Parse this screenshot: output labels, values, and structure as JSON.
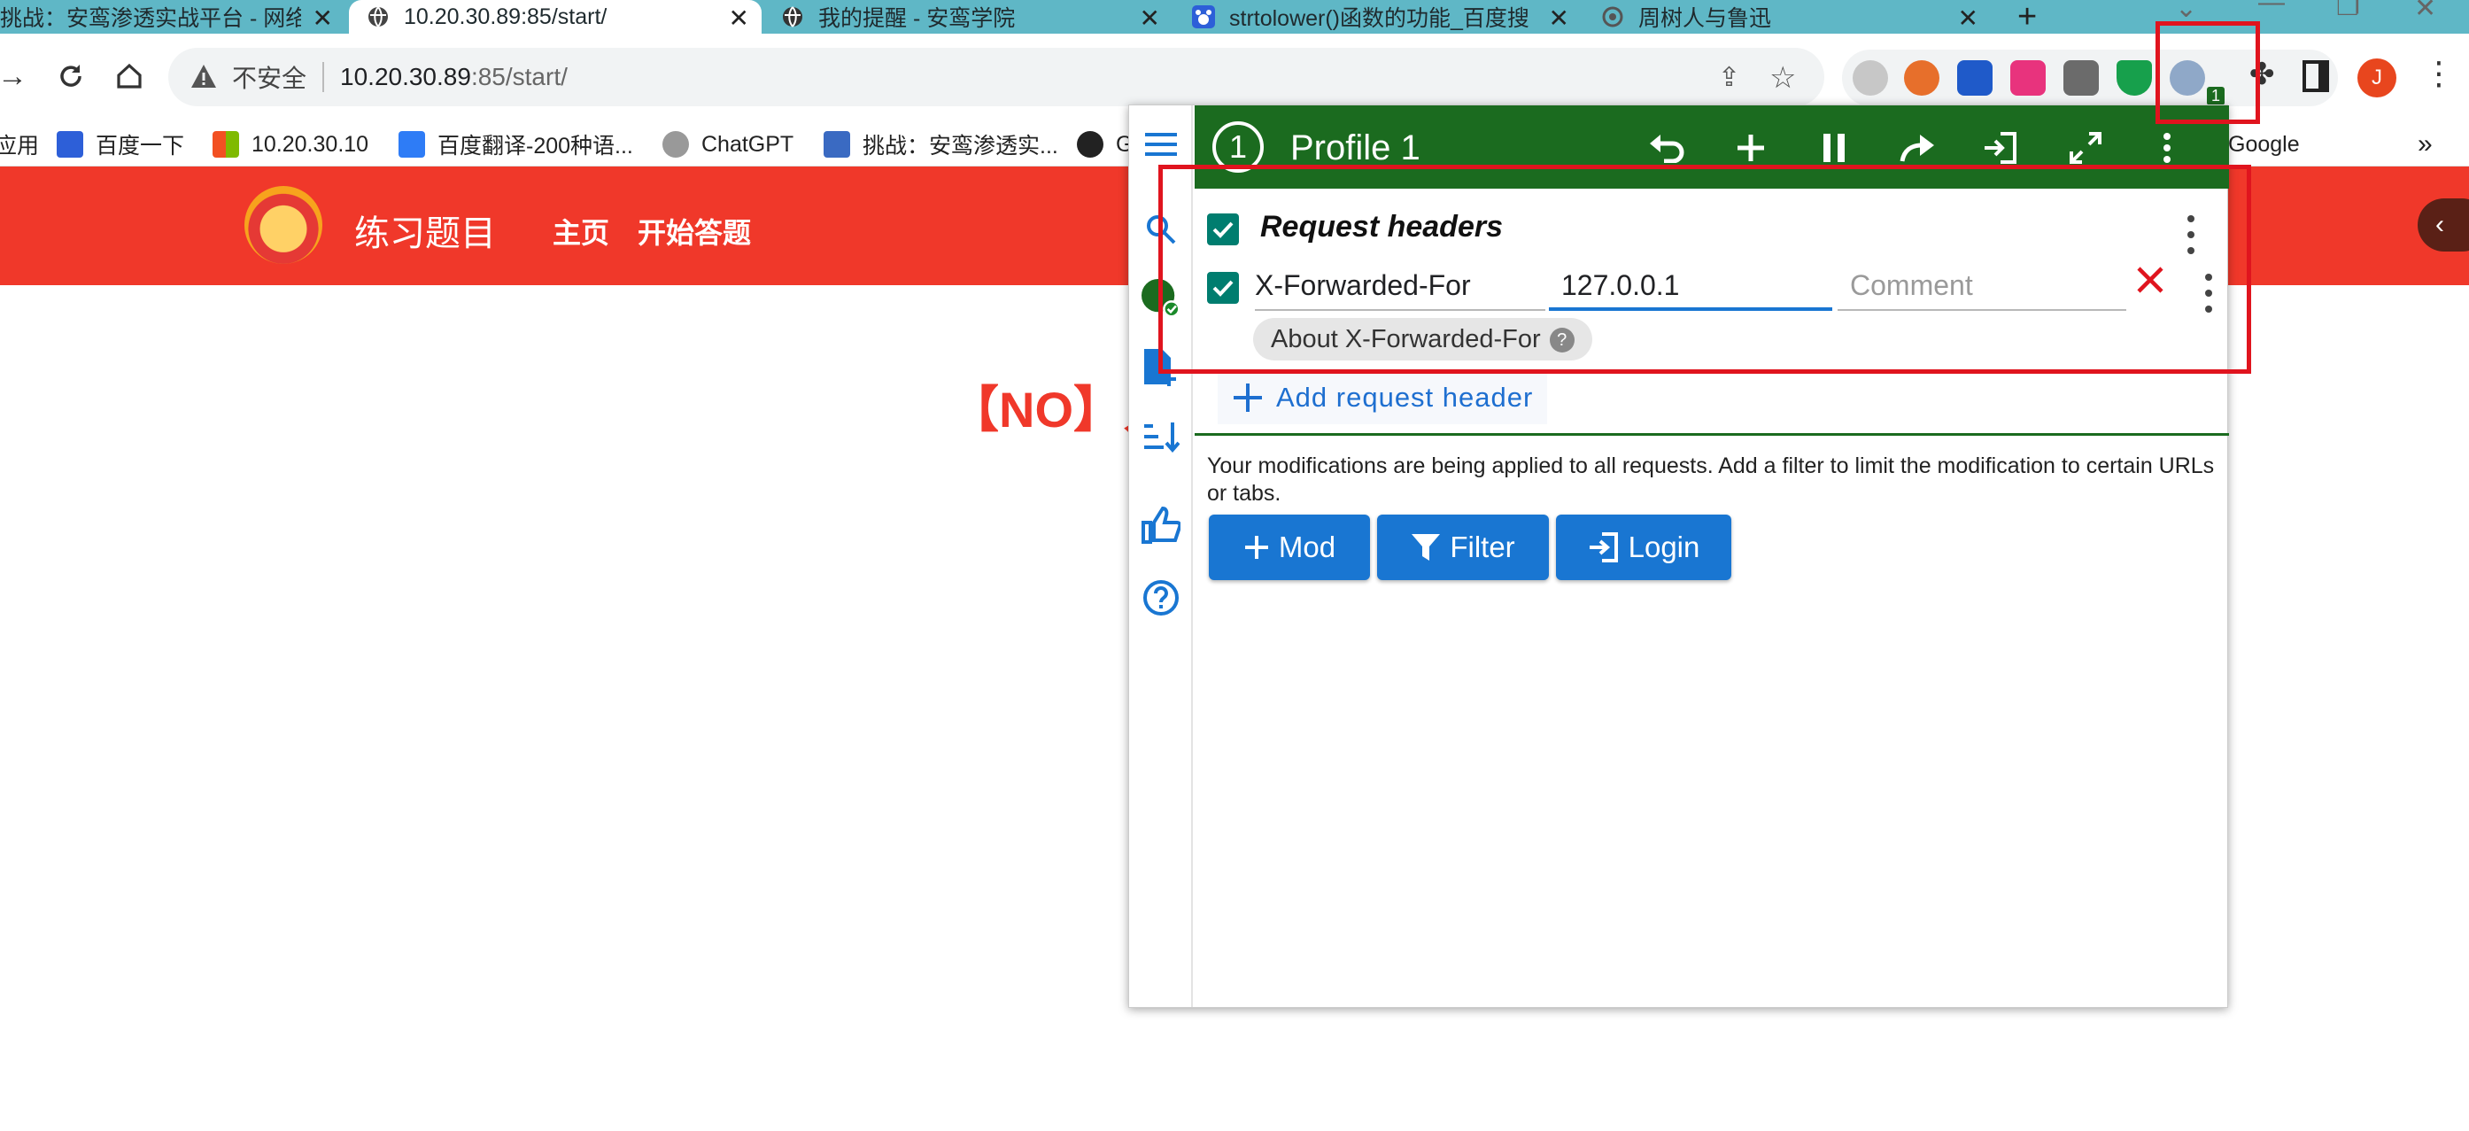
{
  "tabs": [
    {
      "title": "挑战：安鸾渗透实战平台 - 网络"
    },
    {
      "title": "10.20.30.89:85/start/"
    },
    {
      "title": "我的提醒 - 安鸾学院"
    },
    {
      "title": "strtolower()函数的功能_百度搜"
    },
    {
      "title": "周树人与鲁迅"
    }
  ],
  "toolbar": {
    "security": "不安全",
    "url_host": "10.20.30.89",
    "url_rest": ":85/start/",
    "profile_initial": "J",
    "extension_badge": "1"
  },
  "bookmarks": [
    {
      "label": "应用"
    },
    {
      "label": "百度一下"
    },
    {
      "label": "10.20.30.10"
    },
    {
      "label": "百度翻译-200种语..."
    },
    {
      "label": "ChatGPT"
    },
    {
      "label": "挑战：安鸾渗透实..."
    },
    {
      "label": "G"
    },
    {
      "label": "Google"
    },
    {
      "label": "»"
    }
  ],
  "site": {
    "name": "练习题目",
    "nav_home": "主页",
    "nav_start": "开始答题",
    "side_tab": "‹",
    "message": "【NO】只"
  },
  "modheader": {
    "profile_number": "1",
    "profile_name": "Profile 1",
    "section_title": "Request headers",
    "header_name": "X-Forwarded-For",
    "header_value": "127.0.0.1",
    "comment_placeholder": "Comment",
    "about_chip": "About X-Forwarded-For",
    "about_q": "?",
    "add_header": "Add request header",
    "info_text": "Your modifications are being applied to all requests. Add a filter to limit the modification to certain URLs or tabs.",
    "btn_mod": "Mod",
    "btn_filter": "Filter",
    "btn_login": "Login"
  },
  "colors": {
    "tabstrip": "#5fb7c6",
    "site_header": "#f0382a",
    "modheader_green": "#1b6b1f",
    "teal_checkbox": "#007d6f",
    "action_blue": "#1976d2",
    "highlight_red": "#e0141e"
  }
}
